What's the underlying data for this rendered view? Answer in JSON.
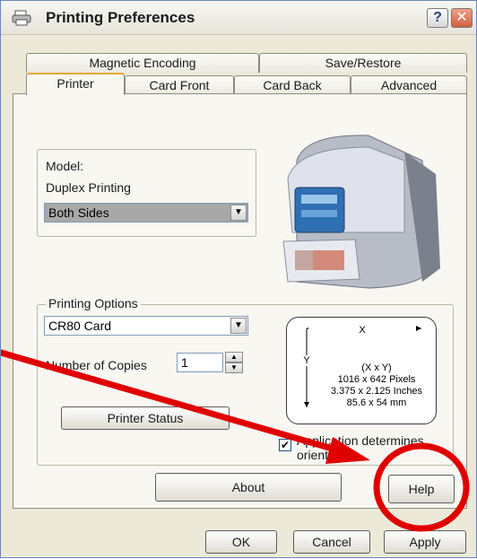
{
  "window": {
    "title": "Printing Preferences"
  },
  "title_buttons": {
    "help": "?",
    "close": "✕"
  },
  "tabs_top": [
    {
      "label": "Magnetic Encoding"
    },
    {
      "label": "Save/Restore"
    }
  ],
  "tabs_bottom": [
    {
      "label": "Printer",
      "active": true
    },
    {
      "label": "Card Front"
    },
    {
      "label": "Card Back"
    },
    {
      "label": "Advanced"
    }
  ],
  "model": {
    "label": "Model:",
    "duplex_label": "Duplex Printing",
    "duplex_value": "Both Sides"
  },
  "printing_options": {
    "label": "Printing Options",
    "card_type": "CR80 Card",
    "copies_label": "Number of Copies",
    "copies_value": "1",
    "printer_status_button": "Printer Status",
    "app_orientation_label": "Application determines orientation",
    "app_orientation_checked": true
  },
  "dimensions": {
    "x": "X",
    "y": "Y",
    "line1": "(X x Y)",
    "line2": "1016 x 642 Pixels",
    "line3": "3.375 x 2.125 Inches",
    "line4": "85.6 x 54 mm"
  },
  "actions": {
    "about": "About",
    "help": "Help",
    "ok": "OK",
    "cancel": "Cancel",
    "apply": "Apply"
  },
  "annotation": {
    "color": "#e00000"
  }
}
